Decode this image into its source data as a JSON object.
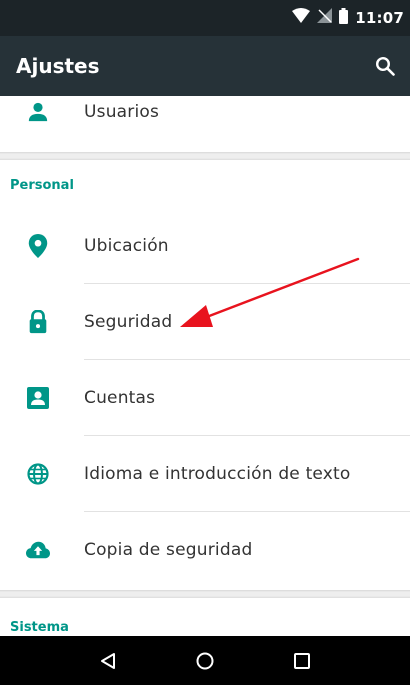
{
  "status_bar": {
    "time": "11:07"
  },
  "toolbar": {
    "title": "Ajustes"
  },
  "items": {
    "usuarios": "Usuarios",
    "ubicacion": "Ubicación",
    "seguridad": "Seguridad",
    "cuentas": "Cuentas",
    "idioma": "Idioma e introducción de texto",
    "copia": "Copia de seguridad"
  },
  "sections": {
    "personal": "Personal",
    "sistema": "Sistema"
  },
  "colors": {
    "accent": "#009688",
    "toolbar": "#263238",
    "status_bar": "#1c2428",
    "annotation_arrow": "#e8131e"
  }
}
